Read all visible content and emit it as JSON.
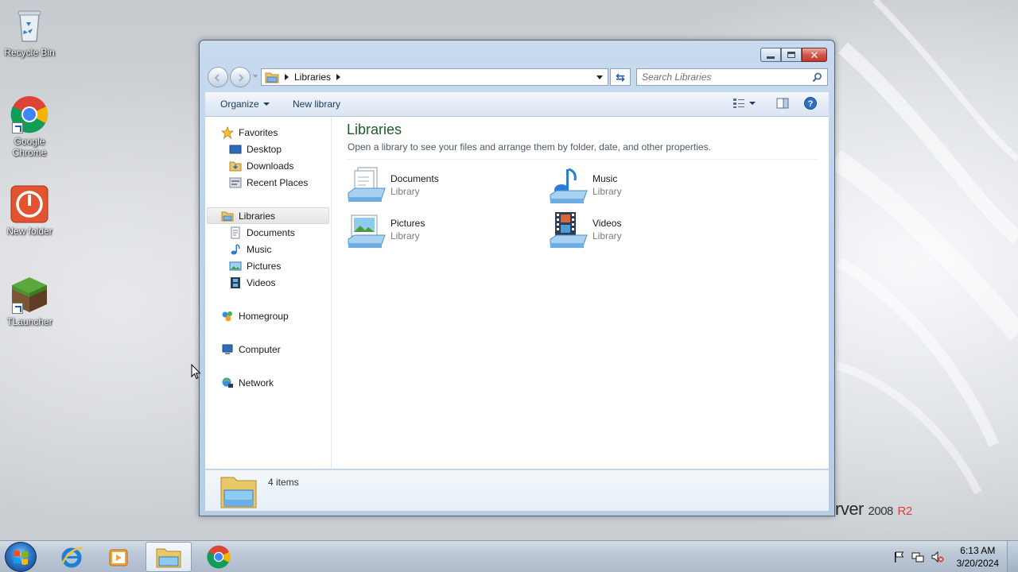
{
  "desktop": {
    "icons": [
      {
        "label": "Recycle Bin"
      },
      {
        "label": "Google Chrome"
      },
      {
        "label": "New folder"
      },
      {
        "label": "TLauncher"
      }
    ],
    "brand": {
      "text": "rver",
      "year": "2008",
      "suffix": "R2"
    }
  },
  "window": {
    "address": {
      "crumb": "Libraries"
    },
    "search": {
      "placeholder": "Search Libraries"
    },
    "toolbar": {
      "organize": "Organize",
      "new_library": "New library"
    },
    "nav": {
      "favorites": "Favorites",
      "desktop": "Desktop",
      "downloads": "Downloads",
      "recent_places": "Recent Places",
      "libraries": "Libraries",
      "documents": "Documents",
      "music": "Music",
      "pictures": "Pictures",
      "videos": "Videos",
      "homegroup": "Homegroup",
      "computer": "Computer",
      "network": "Network"
    },
    "main": {
      "title": "Libraries",
      "description": "Open a library to see your files and arrange them by folder, date, and other properties.",
      "libraries": [
        {
          "name": "Documents",
          "kind": "Library",
          "icon": "documents-library-icon"
        },
        {
          "name": "Music",
          "kind": "Library",
          "icon": "music-library-icon"
        },
        {
          "name": "Pictures",
          "kind": "Library",
          "icon": "pictures-library-icon"
        },
        {
          "name": "Videos",
          "kind": "Library",
          "icon": "videos-library-icon"
        }
      ]
    },
    "details": {
      "count": "4 items"
    }
  },
  "taskbar": {
    "clock": {
      "time": "6:13 AM",
      "date": "3/20/2024"
    }
  },
  "colors": {
    "title_green": "#1e5d2a",
    "toolbar_text": "#1e395b",
    "close_red": "#c0392b"
  }
}
